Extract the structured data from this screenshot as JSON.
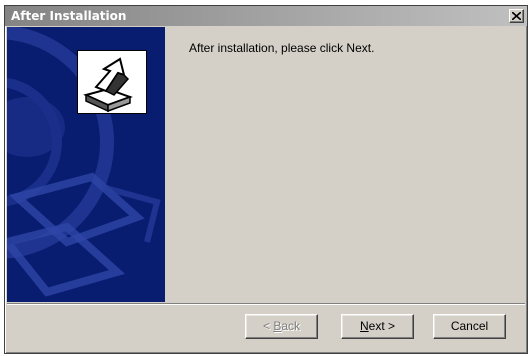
{
  "window": {
    "title": "After Installation",
    "close_icon": "close-icon"
  },
  "side_panel": {
    "logo_icon": "install-arrow-icon",
    "background": "#081c70"
  },
  "content": {
    "message": "After installation, please click Next."
  },
  "buttons": {
    "back": {
      "prefix": "< ",
      "accel": "B",
      "rest": "ack",
      "enabled": false
    },
    "next": {
      "accel": "N",
      "rest": "ext >",
      "enabled": true
    },
    "cancel": {
      "label": "Cancel",
      "enabled": true
    }
  }
}
